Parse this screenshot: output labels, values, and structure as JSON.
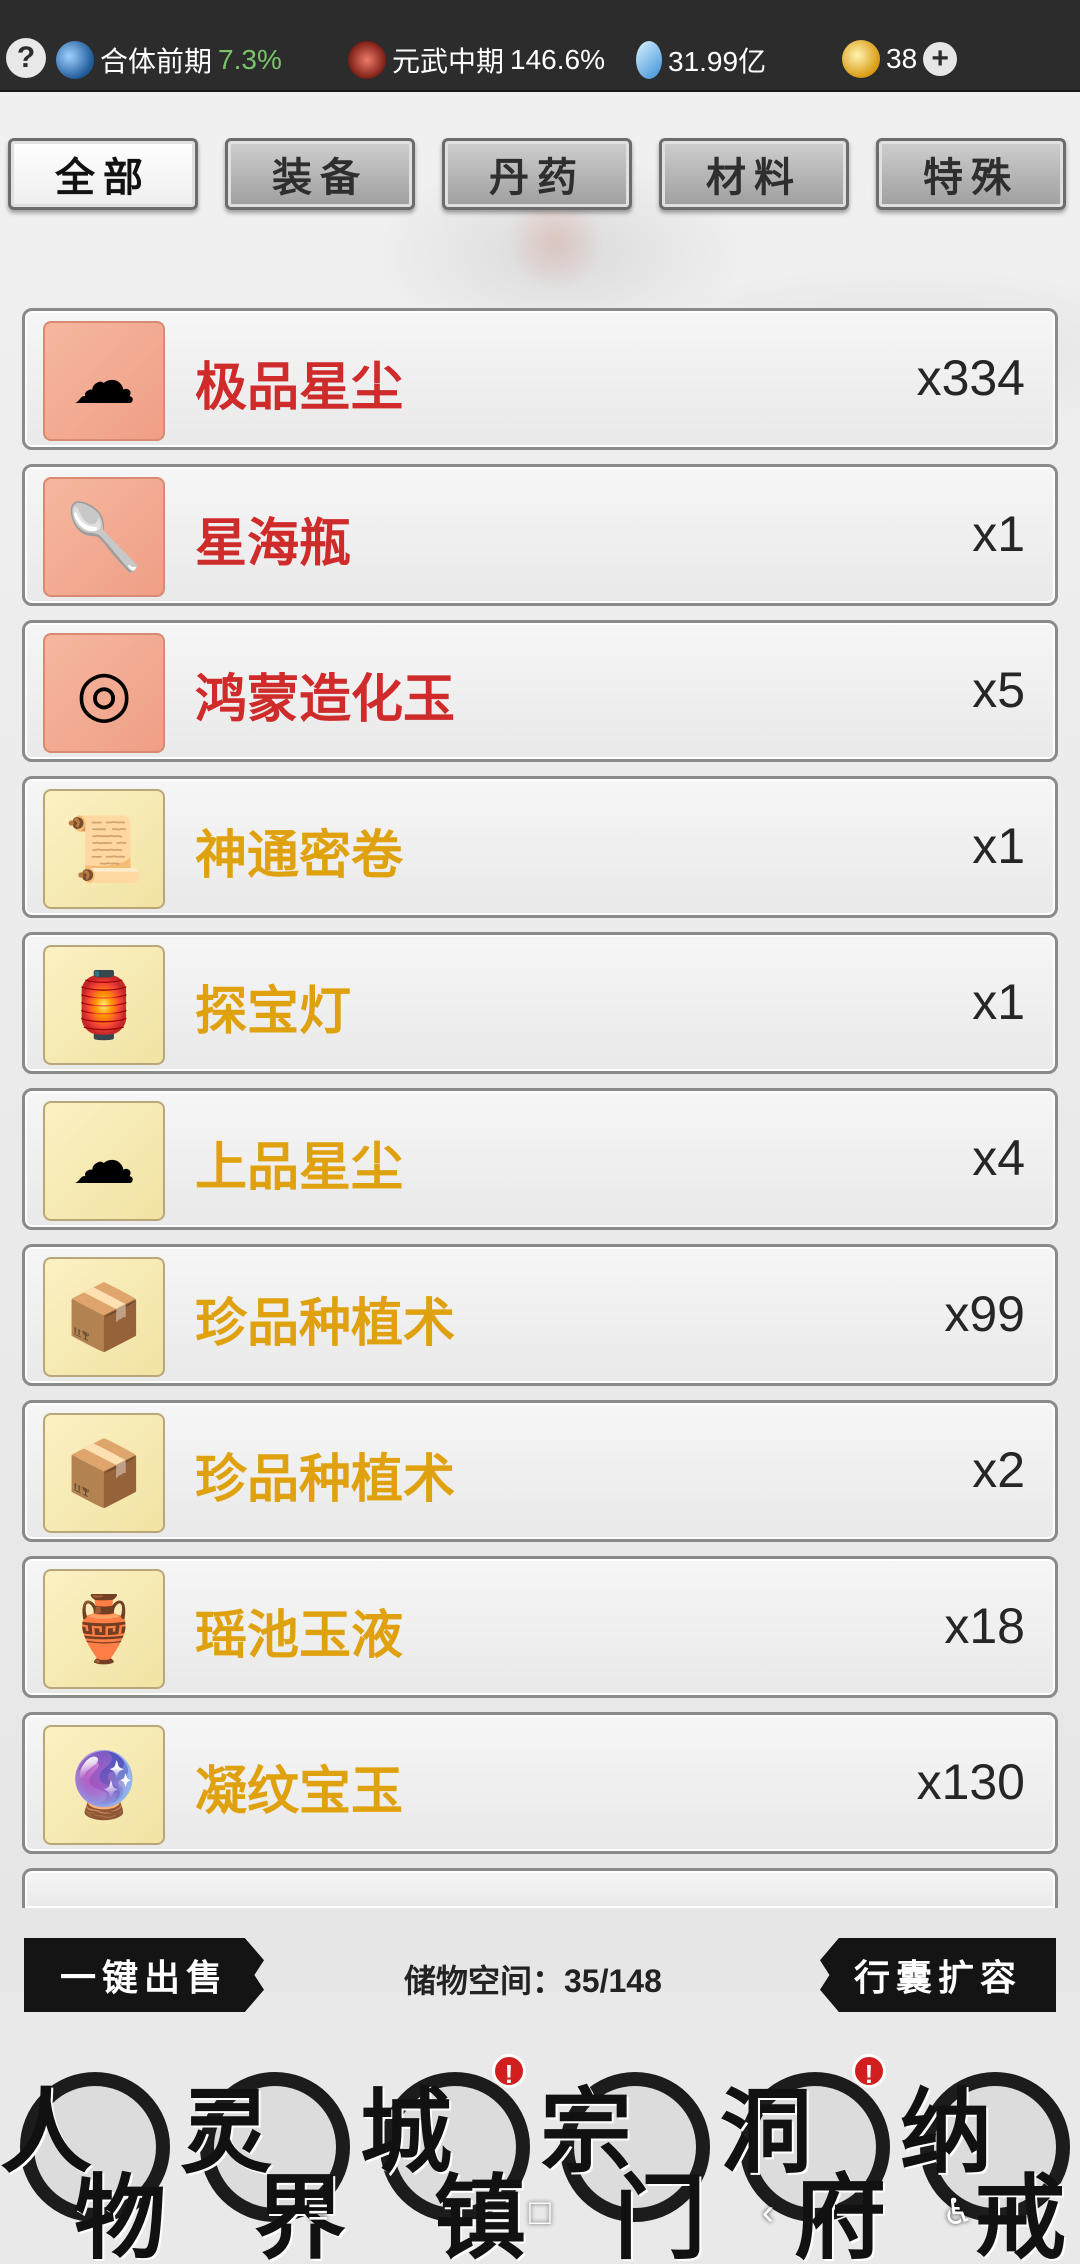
{
  "topbar": {
    "help_label": "?",
    "realm1": {
      "icon": "taiji-icon",
      "label": "合体前期",
      "pct": "7.3%"
    },
    "realm2": {
      "icon": "sword-icon",
      "label": "元武中期",
      "pct": "146.6%"
    },
    "crystals": {
      "icon": "spirit-stone-icon",
      "value": "31.99亿"
    },
    "coins": {
      "icon": "yin-yang-coin-icon",
      "value": "38"
    },
    "add_label": "+"
  },
  "tabs": [
    {
      "label": "全部",
      "active": true
    },
    {
      "label": "装备",
      "active": false
    },
    {
      "label": "丹药",
      "active": false
    },
    {
      "label": "材料",
      "active": false
    },
    {
      "label": "特殊",
      "active": false
    }
  ],
  "items": [
    {
      "name": "极品星尘",
      "qty": "x334",
      "rarity": "red",
      "icon": "stardust-icon"
    },
    {
      "name": "星海瓶",
      "qty": "x1",
      "rarity": "red",
      "icon": "bottle-icon"
    },
    {
      "name": "鸿蒙造化玉",
      "qty": "x5",
      "rarity": "red",
      "icon": "jade-disc-icon"
    },
    {
      "name": "神通密卷",
      "qty": "x1",
      "rarity": "gold",
      "icon": "scroll-icon"
    },
    {
      "name": "探宝灯",
      "qty": "x1",
      "rarity": "gold",
      "icon": "lantern-icon"
    },
    {
      "name": "上品星尘",
      "qty": "x4",
      "rarity": "gold",
      "icon": "stardust-icon"
    },
    {
      "name": "珍品种植术",
      "qty": "x99",
      "rarity": "gold",
      "icon": "manual-icon"
    },
    {
      "name": "珍品种植术",
      "qty": "x2",
      "rarity": "gold",
      "icon": "manual-icon"
    },
    {
      "name": "瑶池玉液",
      "qty": "x18",
      "rarity": "gold",
      "icon": "vase-icon"
    },
    {
      "name": "凝纹宝玉",
      "qty": "x130",
      "rarity": "gold",
      "icon": "gem-icon"
    }
  ],
  "actions": {
    "sell_all": "一键出售",
    "capacity": "储物空间：35/148",
    "expand": "行囊扩容"
  },
  "nav": [
    {
      "c1": "人",
      "c2": "物",
      "badge": false
    },
    {
      "c1": "灵",
      "c2": "界",
      "badge": false
    },
    {
      "c1": "城",
      "c2": "镇",
      "badge": true
    },
    {
      "c1": "宗",
      "c2": "门",
      "badge": false
    },
    {
      "c1": "洞",
      "c2": "府",
      "badge": true
    },
    {
      "c1": "纳",
      "c2": "戒",
      "badge": false
    }
  ],
  "badge_symbol": "!",
  "system_nav": {
    "menu": "≡",
    "home": "□",
    "back": "‹",
    "accessibility": "♿"
  },
  "colors": {
    "rarity_red": "#cf2b2b",
    "rarity_gold": "#e0a10f",
    "progress_green": "#7bc26a",
    "badge_red": "#d11f1f"
  }
}
